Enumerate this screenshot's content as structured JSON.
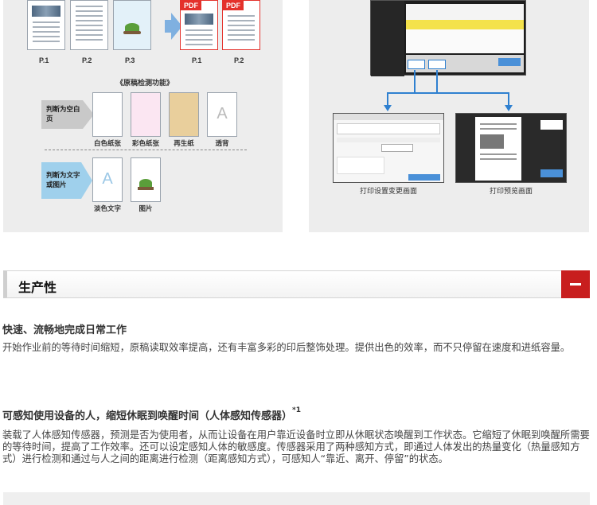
{
  "left_panel": {
    "page_labels": [
      "P.1",
      "P.2",
      "P.3",
      "P.1",
      "P.2"
    ],
    "pdf_labels": [
      "PDF",
      "PDF"
    ],
    "detection_caption": "《原稿检测功能》",
    "judge_blank": "判断为空白页",
    "judge_text_image": "判断为文字或图片",
    "blank_samples": [
      "白色纸张",
      "彩色纸张",
      "再生纸",
      "透背"
    ],
    "content_samples": [
      "淡色文字",
      "图片"
    ]
  },
  "right_panel": {
    "caption_settings": "打印设置变更画面",
    "caption_preview": "打印预览画面"
  },
  "section": {
    "title": "生产性",
    "toggle_label": "collapse"
  },
  "blocks": [
    {
      "heading": "快速、流畅地完成日常工作",
      "sup": "",
      "text": "开始作业前的等待时间缩短，原稿读取效率提高，还有丰富多彩的印后整饰处理。提供出色的效率，而不只停留在速度和进纸容量。"
    },
    {
      "heading": "可感知使用设备的人，缩短休眠到唤醒时间（人体感知传感器）",
      "sup": "*1",
      "text": "装载了人体感知传感器，预测是否为使用者，从而让设备在用户靠近设备时立即从休眠状态唤醒到工作状态。它缩短了休眠到唤醒所需要的等待时间，提高了工作效率。还可以设定感知人体的敏感度。传感器采用了两种感知方式，即通过人体发出的热量变化（热量感知方式）进行检测和通过与人之间的距离进行检测（距离感知方式），可感知人“靠近、离开、停留”的状态。"
    }
  ],
  "colors": {
    "accent": "#c81e1e",
    "pdf_red": "#e4312b",
    "arrow_blue": "#2f80d0"
  }
}
